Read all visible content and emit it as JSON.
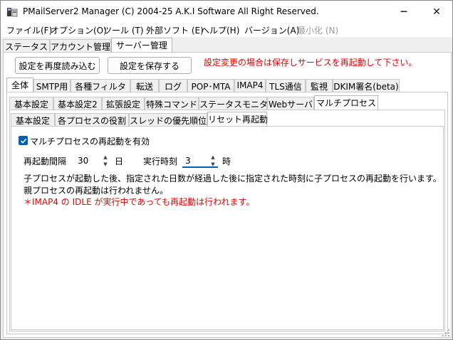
{
  "window": {
    "title": "PMailServer2 Manager (C) 2004-25 A.K.I Software All Right Reserved.",
    "minimize_glyph": "─",
    "maximize_glyph": "☐",
    "close_glyph": "✕"
  },
  "menu": [
    {
      "label": "ファイル(F)",
      "disabled": false
    },
    {
      "label": "オプション(O)",
      "disabled": false
    },
    {
      "label": "ツール (T)",
      "disabled": false
    },
    {
      "label": "外部ソフト (E)",
      "disabled": false
    },
    {
      "label": "ヘルプ(H)",
      "disabled": false
    },
    {
      "label": "バージョン(A)",
      "disabled": false
    },
    {
      "label": "最小化 (N)",
      "disabled": true
    }
  ],
  "top_tabs": [
    "ステータス",
    "アカウント管理",
    "サーバー管理"
  ],
  "top_tabs_active": 2,
  "toolbar": {
    "reload_label": "設定を再度読み込む",
    "save_label": "設定を保存する",
    "warning": "設定変更の場合は保存しサービスを再起動して下さい。"
  },
  "cat_tabs": [
    "全体",
    "SMTP用",
    "各種フィルタ",
    "転送",
    "ログ",
    "POP･MTA",
    "IMAP4",
    "TLS通信",
    "監視",
    "DKIM署名(beta)"
  ],
  "cat_tabs_active": 0,
  "sub_tabs": [
    "基本設定",
    "基本設定2",
    "拡張設定",
    "特殊コマンド",
    "ステータスモニタ",
    "Webサーバ",
    "マルチプロセス"
  ],
  "sub_tabs_active": 6,
  "mp_tabs": [
    "基本設定",
    "各プロセスの役割",
    "スレッドの優先順位",
    "リセット再起動"
  ],
  "mp_tabs_active": 3,
  "restart": {
    "enable_label": "マルチプロセスの再起動を有効",
    "enabled": true,
    "interval_label": "再起動間隔",
    "interval_value": "30",
    "interval_unit": "日",
    "time_label": "実行時刻",
    "time_value": "3",
    "time_unit": "時",
    "desc1": "子プロセスが起動した後、指定された日数が経過した後に指定された時刻に子プロセスの再起動を行います。",
    "desc2": "親プロセスの再起動は行われません。",
    "note": "＊IMAP4 の IDLE が実行中であっても再起動は行われます。"
  },
  "colors": {
    "accent": "#005fb8",
    "warning": "#e00000"
  }
}
